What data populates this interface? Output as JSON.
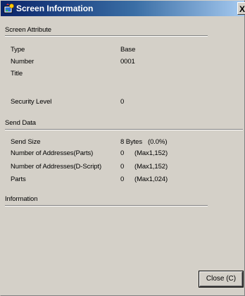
{
  "window": {
    "title": "Screen Information",
    "close_glyph": "X"
  },
  "screen_attribute": {
    "heading": "Screen Attribute",
    "rows": [
      {
        "label": "Type",
        "value": "Base"
      },
      {
        "label": "Number",
        "value": "0001"
      },
      {
        "label": "Title",
        "value": ""
      },
      {
        "label": "Security Level",
        "value": "0"
      }
    ]
  },
  "send_data": {
    "heading": "Send Data",
    "rows": [
      {
        "label": "Send Size",
        "value": "8 Bytes",
        "max": "(0.0%)"
      },
      {
        "label": "Number of Addresses(Parts)",
        "value": "0",
        "max": "(Max1,152)"
      },
      {
        "label": "Number of Addresses(D-Script)",
        "value": "0",
        "max": "(Max1,152)"
      },
      {
        "label": "Parts",
        "value": "0",
        "max": "(Max1,024)"
      }
    ]
  },
  "information": {
    "heading": "Information"
  },
  "buttons": {
    "close_label": "Close (C)"
  }
}
